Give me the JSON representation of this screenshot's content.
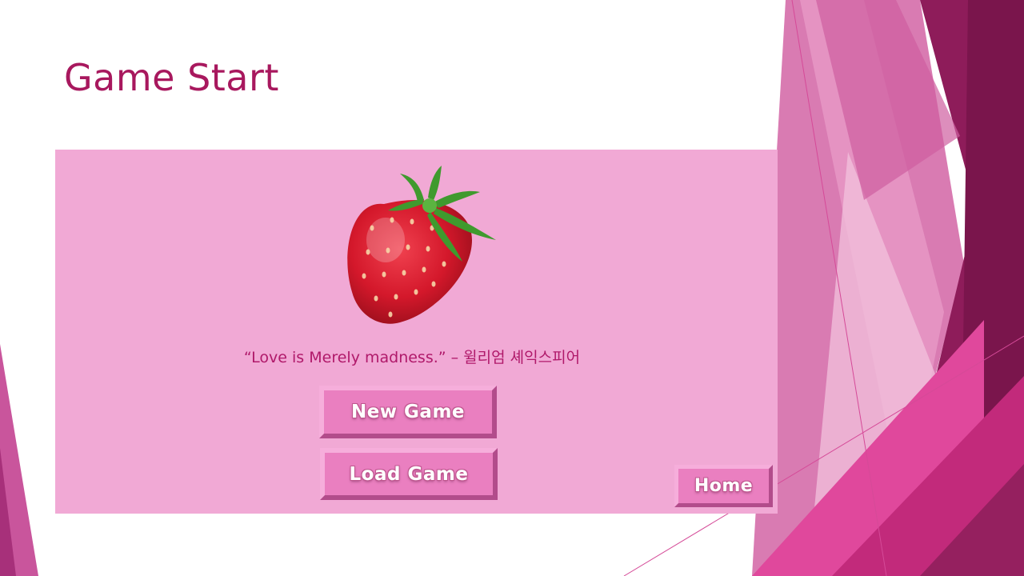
{
  "slide": {
    "title": "Game Start"
  },
  "panel": {
    "image": "strawberry",
    "quote": "“Love is Merely madness.” – 윌리엄 셰익스피어"
  },
  "menu": {
    "new_game_label": "New Game",
    "load_game_label": "Load Game",
    "home_label": "Home"
  },
  "colors": {
    "title": "#a8185e",
    "panel_bg": "#f1a9d5",
    "button_bg": "#ea7fc0",
    "accent_dark": "#8e1a55",
    "accent_mid": "#d6509d"
  }
}
